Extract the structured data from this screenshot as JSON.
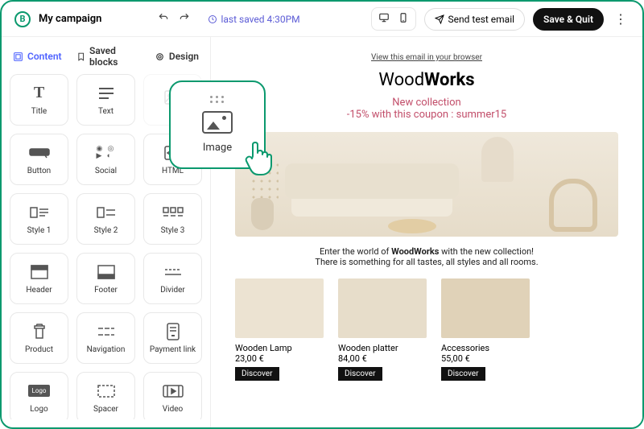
{
  "header": {
    "title": "My campaign",
    "last_saved": "last saved 4:30PM",
    "send_test": "Send test email",
    "save_quit": "Save & Quit"
  },
  "tabs": {
    "content": "Content",
    "saved": "Saved blocks",
    "design": "Design"
  },
  "blocks": [
    {
      "id": "title",
      "label": "Title"
    },
    {
      "id": "text",
      "label": "Text"
    },
    {
      "id": "image",
      "label": ""
    },
    {
      "id": "button",
      "label": "Button"
    },
    {
      "id": "social",
      "label": "Social"
    },
    {
      "id": "html",
      "label": "HTML"
    },
    {
      "id": "style1",
      "label": "Style 1"
    },
    {
      "id": "style2",
      "label": "Style 2"
    },
    {
      "id": "style3",
      "label": "Style 3"
    },
    {
      "id": "header",
      "label": "Header"
    },
    {
      "id": "footer",
      "label": "Footer"
    },
    {
      "id": "divider",
      "label": "Divider"
    },
    {
      "id": "product",
      "label": "Product"
    },
    {
      "id": "navigation",
      "label": "Navigation"
    },
    {
      "id": "payment",
      "label": "Payment link"
    },
    {
      "id": "logo",
      "label": "Logo"
    },
    {
      "id": "spacer",
      "label": "Spacer"
    },
    {
      "id": "video",
      "label": "Video"
    }
  ],
  "drag": {
    "label": "Image"
  },
  "preview": {
    "browser_link": "View this email in your browser",
    "brand_light": "Wood",
    "brand_bold": "Works",
    "promo1": "New collection",
    "promo2": "-15% with this coupon : summer15",
    "intro1": "Enter the world of ",
    "intro_bold": "WoodWorks",
    "intro2": " with the new collection!",
    "intro3": "There is something for all tastes, all styles and all rooms.",
    "discover": "Discover",
    "products": [
      {
        "name": "Wooden Lamp",
        "price": "23,00 €"
      },
      {
        "name": "Wooden platter",
        "price": "84,00 €"
      },
      {
        "name": "Accessories",
        "price": "55,00 €"
      }
    ]
  }
}
